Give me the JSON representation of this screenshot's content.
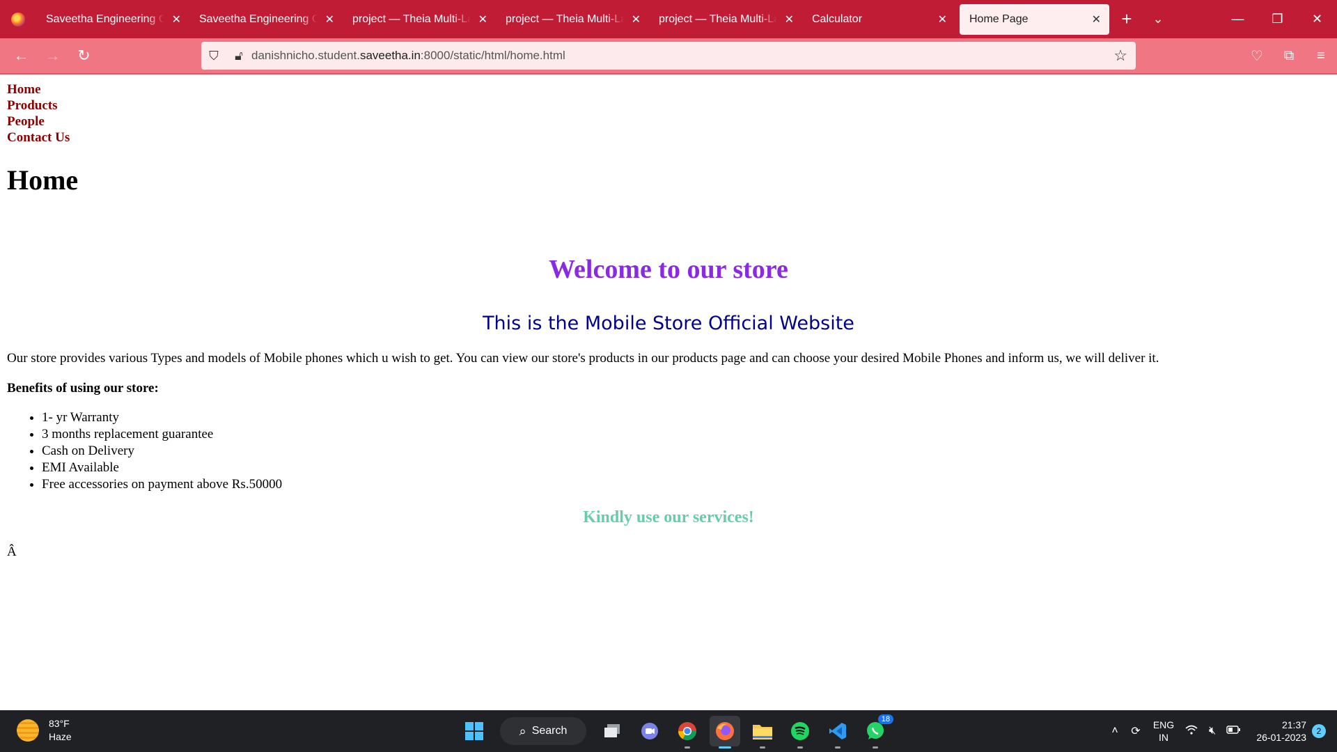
{
  "browser": {
    "tabs": [
      {
        "label": "Saveetha Engineering College"
      },
      {
        "label": "Saveetha Engineering College"
      },
      {
        "label": "project — Theia Multi-Language"
      },
      {
        "label": "project — Theia Multi-Language"
      },
      {
        "label": "project — Theia Multi-Language"
      },
      {
        "label": "Calculator"
      },
      {
        "label": "Home Page"
      }
    ],
    "url_prefix": "danishnicho.student.",
    "url_host": "saveetha.in",
    "url_suffix": ":8000/static/html/home.html"
  },
  "site_nav": [
    "Home",
    "Products",
    "People",
    "Contact Us"
  ],
  "page": {
    "title": "Home",
    "welcome": "Welcome to our store",
    "subtitle": "This is the Mobile Store Official Website",
    "intro": "Our store provides various Types and models of Mobile phones which u wish to get. You can view our store's products in our products page and can choose your desired Mobile Phones and inform us, we will deliver it.",
    "benefits_heading": "Benefits of using our store:",
    "benefits": [
      "1- yr Warranty",
      "3 months replacement guarantee",
      "Cash on Delivery",
      "EMI Available",
      "Free accessories on payment above Rs.50000"
    ],
    "closing": "Kindly use our services!",
    "stray_char": "Â"
  },
  "taskbar": {
    "temperature": "83°F",
    "condition": "Haze",
    "search_label": "Search",
    "whatsapp_badge": "18",
    "lang_top": "ENG",
    "lang_bottom": "IN",
    "time": "21:37",
    "date": "26-01-2023",
    "notifications": "2"
  },
  "colors": {
    "tab_strip": "#c01c35",
    "nav_bar": "#ef7682",
    "nav_link": "#8b0000",
    "welcome": "#8a2be2",
    "subtitle": "#00008b",
    "closing": "#66cdaa"
  }
}
